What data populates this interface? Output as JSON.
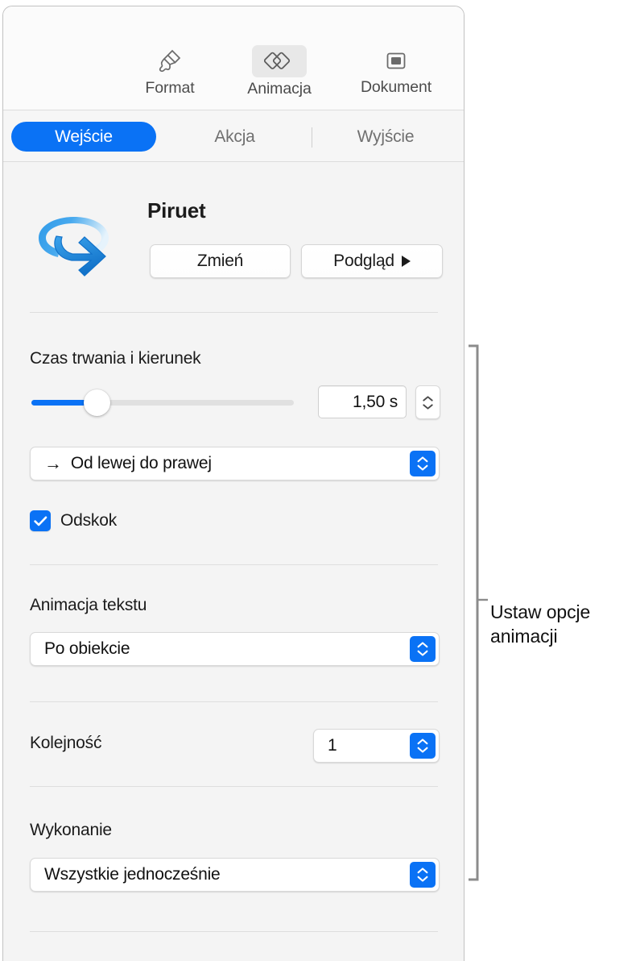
{
  "panel": {
    "tool_tabs": [
      {
        "id": "format",
        "label": "Format",
        "icon": "paintbrush-icon",
        "active": false
      },
      {
        "id": "animacja",
        "label": "Animacja",
        "icon": "animate-shapes-icon",
        "active": true
      },
      {
        "id": "dokument",
        "label": "Dokument",
        "icon": "document-slide-icon",
        "active": false
      }
    ],
    "segments": [
      {
        "id": "wejscie",
        "label": "Wejście",
        "selected": true
      },
      {
        "id": "akcja",
        "label": "Akcja",
        "selected": false
      },
      {
        "id": "wyjscie",
        "label": "Wyjście",
        "selected": false
      }
    ],
    "animation": {
      "name": "Piruet",
      "icon": "spin-arrow-icon",
      "change_button": "Zmień",
      "preview_button": "Podgląd"
    },
    "duration": {
      "section_label": "Czas trwania i kierunek",
      "slider_value_ratio": 0.26,
      "field_value": "1,50 s",
      "stepper": "duration-stepper"
    },
    "direction": {
      "arrow_glyph": "→",
      "value": "Od lewej do prawej"
    },
    "bounce": {
      "label": "Odskok",
      "checked": true
    },
    "text_animation": {
      "section_label": "Animacja tekstu",
      "value": "Po obiekcie"
    },
    "order": {
      "label": "Kolejność",
      "value": "1"
    },
    "execution": {
      "section_label": "Wykonanie",
      "value": "Wszystkie jednocześnie"
    },
    "colors": {
      "accent_blue": "#0a72f5",
      "panel_background": "#f4f4f4",
      "divider": "#dedede"
    }
  },
  "callout": {
    "text": "Ustaw opcje animacji"
  }
}
